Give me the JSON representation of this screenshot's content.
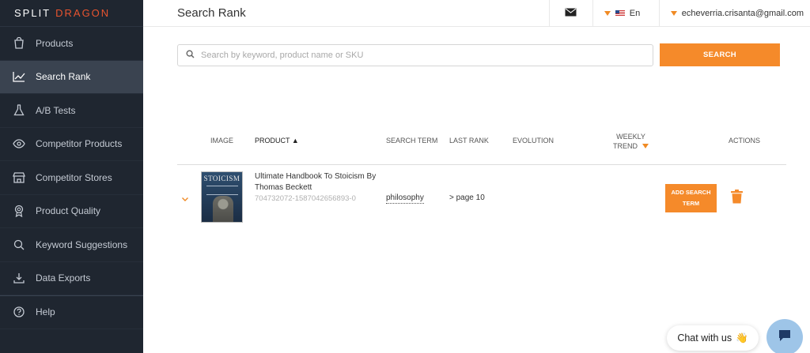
{
  "brand": {
    "part1": "SPLIT",
    "part2": "DRAGON"
  },
  "sidebar": {
    "items": [
      {
        "label": "Products",
        "icon": "bag-icon"
      },
      {
        "label": "Search Rank",
        "icon": "trend-chart-icon",
        "active": true
      },
      {
        "label": "A/B Tests",
        "icon": "flask-icon"
      },
      {
        "label": "Competitor Products",
        "icon": "eye-icon"
      },
      {
        "label": "Competitor Stores",
        "icon": "store-icon"
      },
      {
        "label": "Product Quality",
        "icon": "award-icon"
      },
      {
        "label": "Keyword Suggestions",
        "icon": "search-icon"
      },
      {
        "label": "Data Exports",
        "icon": "download-icon"
      },
      {
        "label": "Help",
        "icon": "help-icon"
      }
    ]
  },
  "header": {
    "title": "Search Rank",
    "language": "En",
    "user_email": "echeverria.crisanta@gmail.com"
  },
  "search": {
    "placeholder": "Search by keyword, product name or SKU",
    "value": "",
    "button_label": "SEARCH"
  },
  "table": {
    "columns": {
      "image": "IMAGE",
      "product": "PRODUCT ▲",
      "search_term": "SEARCH TERM",
      "last_rank": "LAST RANK",
      "evolution": "EVOLUTION",
      "weekly_trend_1": "WEEKLY",
      "weekly_trend_2": "TREND",
      "actions": "ACTIONS"
    },
    "rows": [
      {
        "cover_title": "STOICISM",
        "product_title": "Ultimate Handbook To Stoicism By Thomas Beckett",
        "sku": "704732072-1587042656893-0",
        "search_term": "philosophy",
        "last_rank": "> page 10",
        "evolution": "",
        "add_label": "ADD SEARCH TERM"
      }
    ]
  },
  "chat": {
    "label": "Chat with us",
    "emoji": "👋"
  },
  "colors": {
    "accent": "#f58a2a",
    "sidebar_bg": "#1f2630",
    "sidebar_active": "#3a4350",
    "brand_red": "#e8542f"
  }
}
